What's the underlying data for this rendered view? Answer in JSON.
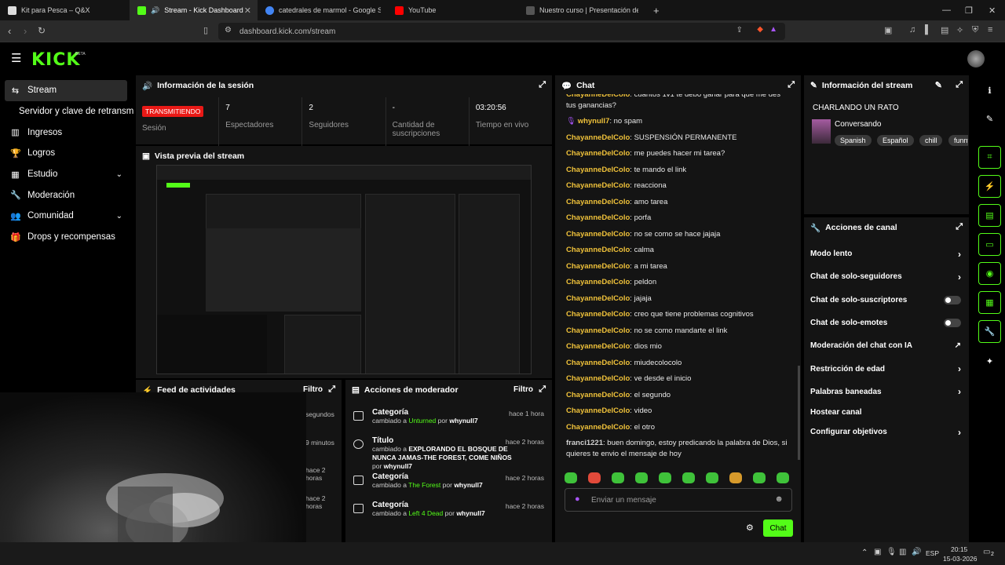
{
  "browser": {
    "tabs": [
      {
        "title": "Kit para Pesca – Q&X",
        "color": "#dddddd"
      },
      {
        "title": "Stream - Kick Dashboard",
        "color": "#53fc18"
      },
      {
        "title": "catedrales de marmol - Google Search",
        "color": "#4285f4"
      },
      {
        "title": "YouTube",
        "color": "#ff0000"
      },
      {
        "title": "Nuestro curso | Presentación del curso",
        "color": "#555555"
      }
    ],
    "new_tab": "+",
    "url": "dashboard.kick.com/stream"
  },
  "brand": {
    "logo": "KICK",
    "beta": "BETA"
  },
  "sidebar": {
    "items": [
      {
        "label": "Stream",
        "icon": "dual-arrows-icon"
      },
      {
        "label": "Servidor y clave de retransmisión"
      },
      {
        "label": "Ingresos",
        "icon": "bar-chart-icon"
      },
      {
        "label": "Logros",
        "icon": "trophy-icon"
      },
      {
        "label": "Estudio",
        "icon": "grid-icon"
      },
      {
        "label": "Moderación",
        "icon": "wrench-icon"
      },
      {
        "label": "Comunidad",
        "icon": "people-icon"
      },
      {
        "label": "Drops y recompensas",
        "icon": "gift-icon"
      }
    ]
  },
  "session": {
    "title": "Información de la sesión",
    "stats": [
      {
        "value": "TRANSMITIENDO",
        "label": "Sesión"
      },
      {
        "value": "7",
        "label": "Espectadores"
      },
      {
        "value": "2",
        "label": "Seguidores"
      },
      {
        "value": "-",
        "label": "Cantidad de suscripciones"
      },
      {
        "value": "03:20:56",
        "label": "Tiempo en vivo"
      }
    ]
  },
  "preview": {
    "title": "Vista previa del stream"
  },
  "feed": {
    "title": "Feed de actividades",
    "filter": "Filtro",
    "times": [
      "segundos",
      "9 minutos",
      "hace 2 horas",
      "hace 2 horas"
    ]
  },
  "mod_actions": {
    "title": "Acciones de moderador",
    "filter": "Filtro",
    "rows": [
      {
        "type": "Categoría",
        "prefix": "cambiado a ",
        "value": "Unturned",
        "by": "por",
        "user": "whynull7",
        "time": "hace 1 hora"
      },
      {
        "type": "Título",
        "prefix": "cambiado a ",
        "value": "EXPLORANDO EL BOSQUE DE NUNCA JAMAS-THE FOREST, COME NIÑOS",
        "by": "por",
        "user": "whynull7",
        "time": "hace 2 horas"
      },
      {
        "type": "Categoría",
        "prefix": "cambiado a ",
        "value": "The Forest",
        "by": "por",
        "user": "whynull7",
        "time": "hace 2 horas"
      },
      {
        "type": "Categoría",
        "prefix": "cambiado a ",
        "value": "Left 4 Dead",
        "by": "por",
        "user": "whynull7",
        "time": "hace 2 horas"
      }
    ]
  },
  "chat": {
    "title": "Chat",
    "messages": [
      {
        "user": "ChayanneDelColo",
        "text": "cuantos 1v1 te debo ganar para que me des tus ganancias?"
      },
      {
        "user": "whynull7",
        "text": "no spam"
      },
      {
        "user": "ChayanneDelColo",
        "text": "SUSPENSIÓN PERMANENTE"
      },
      {
        "user": "ChayanneDelColo",
        "text": "me puedes hacer mi tarea?"
      },
      {
        "user": "ChayanneDelColo",
        "text": "te mando el link"
      },
      {
        "user": "ChayanneDelColo",
        "text": "reacciona"
      },
      {
        "user": "ChayanneDelColo",
        "text": "amo tarea"
      },
      {
        "user": "ChayanneDelColo",
        "text": "porfa"
      },
      {
        "user": "ChayanneDelColo",
        "text": "no se como se hace jajaja"
      },
      {
        "user": "ChayanneDelColo",
        "text": "calma"
      },
      {
        "user": "ChayanneDelColo",
        "text": "a mi tarea"
      },
      {
        "user": "ChayanneDelColo",
        "text": "peldon"
      },
      {
        "user": "ChayanneDelColo",
        "text": "jajaja"
      },
      {
        "user": "ChayanneDelColo",
        "text": "creo que tiene problemas cognitivos"
      },
      {
        "user": "ChayanneDelColo",
        "text": "no se como mandarte el link"
      },
      {
        "user": "ChayanneDelColo",
        "text": "dios mio"
      },
      {
        "user": "ChayanneDelColo",
        "text": "miudecolocolo"
      },
      {
        "user": "ChayanneDelColo",
        "text": "ve desde el inicio"
      },
      {
        "user": "ChayanneDelColo",
        "text": "el segundo"
      },
      {
        "user": "ChayanneDelColo",
        "text": "video"
      },
      {
        "user": "ChayanneDelColo",
        "text": "el otro"
      },
      {
        "user": "franci1221",
        "text": "buen domingo, estoy predicando la palabra de Dios, si quieres te envio el mensaje de hoy"
      }
    ],
    "placeholder": "Enviar un mensaje",
    "send": "Chat"
  },
  "stream_info": {
    "title": "Información del stream",
    "stream_title": "CHARLANDO UN RATO",
    "category": "Conversando",
    "tags": [
      "Spanish",
      "Español",
      "chill",
      "funny"
    ]
  },
  "channel_actions": {
    "title": "Acciones de canal",
    "items": [
      {
        "label": "Modo lento",
        "control": "arrow"
      },
      {
        "label": "Chat de solo-seguidores",
        "control": "arrow"
      },
      {
        "label": "Chat de solo-suscriptores",
        "control": "toggle"
      },
      {
        "label": "Chat de solo-emotes",
        "control": "toggle"
      },
      {
        "label": "Moderación del chat con IA",
        "control": "external"
      },
      {
        "label": "Restricción de edad",
        "control": "arrow"
      },
      {
        "label": "Palabras baneadas",
        "control": "arrow"
      },
      {
        "label": "Hostear canal",
        "control": "none"
      },
      {
        "label": "Configurar objetivos",
        "control": "arrow"
      }
    ]
  },
  "taskbar": {
    "lang": "ESP",
    "time": "20:15",
    "date": "15-03-2026",
    "badge": "2"
  }
}
